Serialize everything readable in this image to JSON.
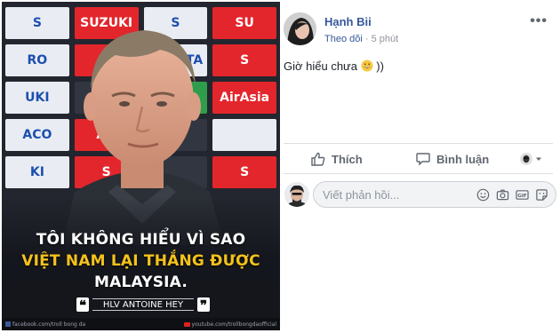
{
  "meme": {
    "backdrop_tiles": [
      "S",
      "SUZUKI",
      "S",
      "SU",
      "RO",
      "S",
      "TOYOTA",
      "S",
      "UKI",
      "",
      "",
      "AirAsia",
      "ACO",
      "Air",
      "",
      "",
      "KI",
      "S",
      "",
      "S"
    ],
    "quote_line1": "TÔI KHÔNG HIỂU VÌ SAO",
    "quote_line2": "VIỆT NAM LẠI THẮNG ĐƯỢC",
    "quote_line3": "MALAYSIA.",
    "attribution": "HLV ANTOINE HEY",
    "open_quote": "❝",
    "close_quote": "❞",
    "footer_left": "facebook.com/troll bong da",
    "footer_right": "youtube.com/trollbongdaofficial"
  },
  "post": {
    "author": "Hạnh Bii",
    "follow": "Theo dõi",
    "separator": "·",
    "time": "5 phút",
    "more": "•••",
    "message": "Giờ hiểu chưa",
    "message_suffix": "))",
    "actions": {
      "like": "Thích",
      "comment": "Bình luận"
    },
    "comment_placeholder": "Viết phản hồi...",
    "icons": {
      "like": "thumbs-up-icon",
      "comment": "speech-bubble-icon",
      "emoji": "smiley-icon",
      "camera": "camera-icon",
      "gif": "gif-icon",
      "sticker": "sticker-icon"
    },
    "colors": {
      "link_blue": "#365899",
      "muted": "#90949c",
      "action": "#606770"
    }
  }
}
